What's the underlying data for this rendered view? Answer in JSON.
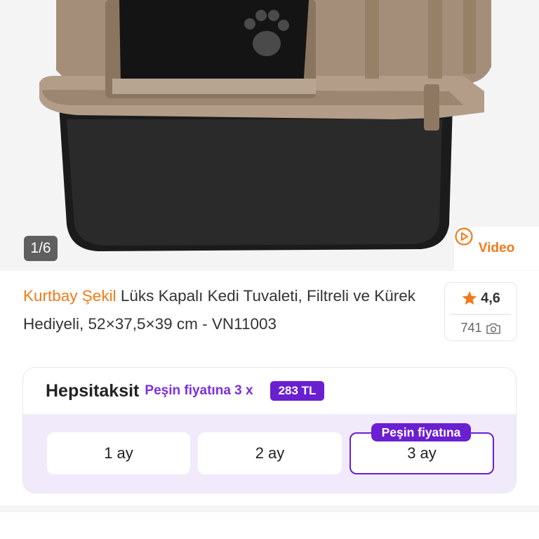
{
  "gallery": {
    "counter": "1/6",
    "video_label": "Video"
  },
  "product": {
    "brand": "Kurtbay Şekil",
    "title": "Lüks Kapalı Kedi Tuvaleti, Filtreli ve Kürek Hediyeli, 52×37,5×39 cm - VN11003"
  },
  "rating": {
    "score": "4,6",
    "photo_count": "741"
  },
  "installment": {
    "brand": "Hepsitaksit",
    "offer_label": "Peşin fiyatına 3 x",
    "price": "283 TL",
    "options": [
      "1 ay",
      "2 ay",
      "3 ay"
    ],
    "selected_tag": "Peşin fiyatına"
  },
  "colors": {
    "accent_orange": "#f27a1a",
    "accent_purple": "#6a1fd1",
    "card_tint": "#f1eafb"
  }
}
